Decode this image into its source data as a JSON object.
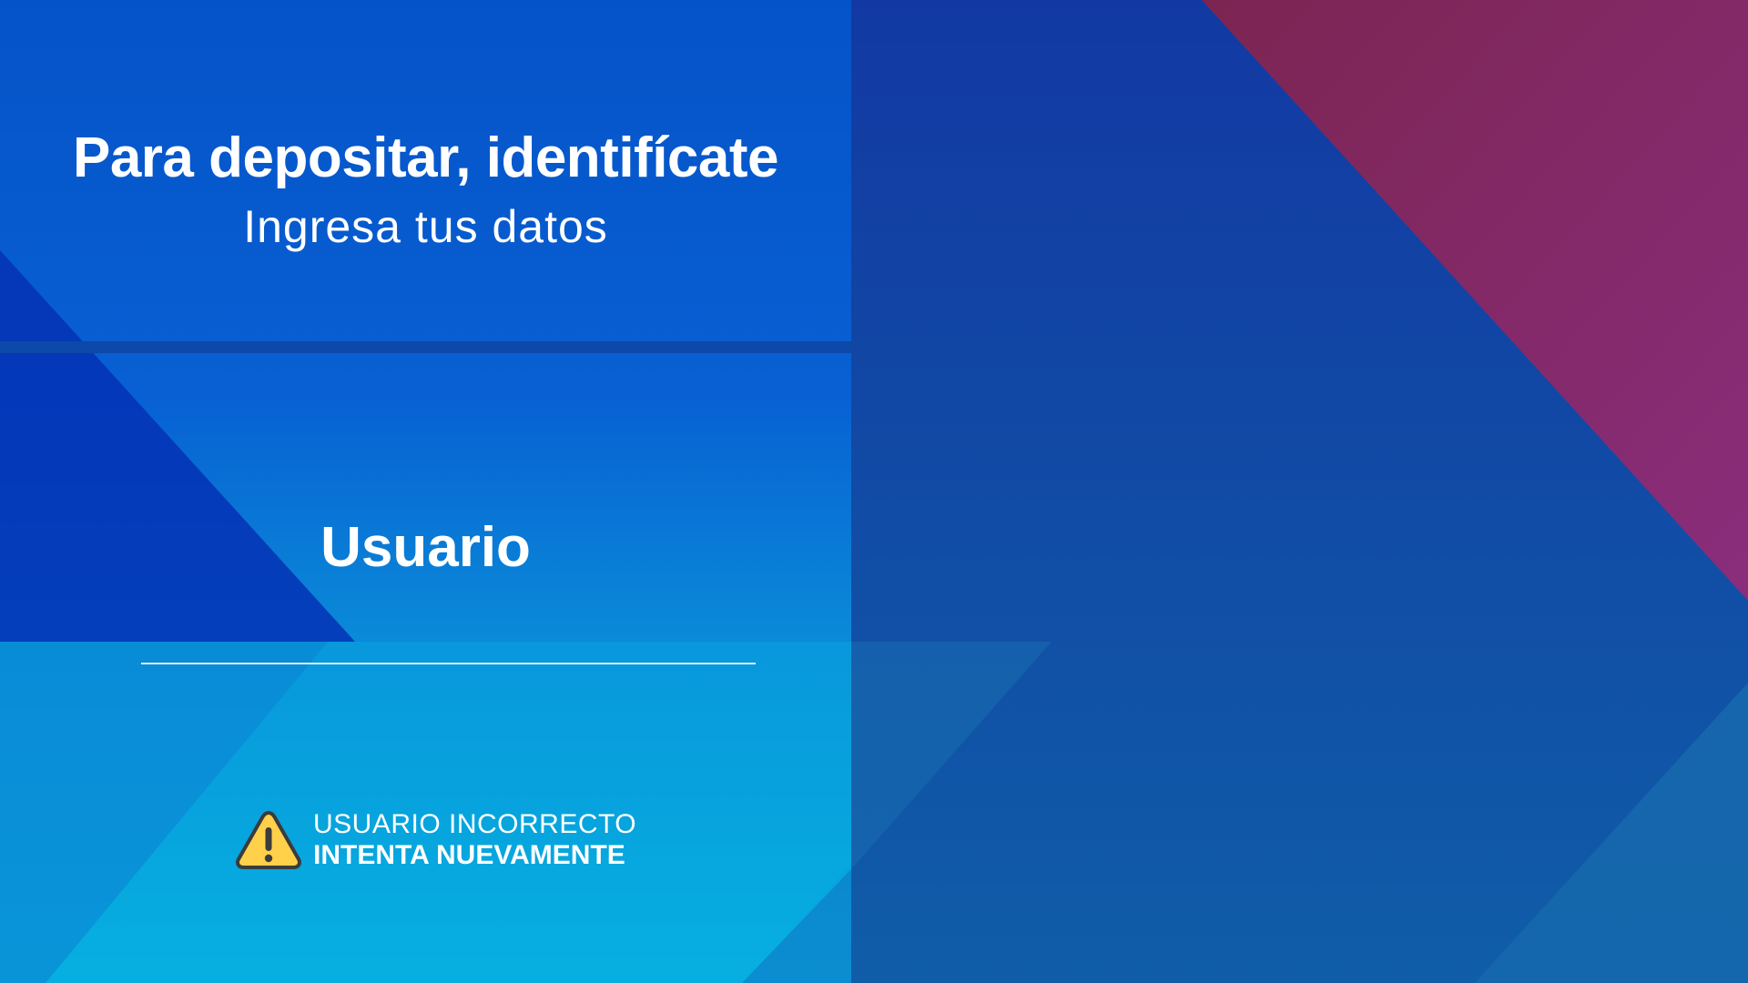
{
  "login": {
    "heading": "Para depositar, identifícate",
    "subheading": "Ingresa tus datos",
    "field_label": "Usuario",
    "user_value": "",
    "error": {
      "icon": "warning-icon",
      "line1": "USUARIO INCORRECTO",
      "line2": "INTENTA NUEVAMENTE"
    }
  },
  "colors": {
    "left_panel_top": "#0553c8",
    "left_panel_bottom": "#08aee0",
    "right_panel": "#1245a5",
    "accent_magenta": "#8b2a6a",
    "divider": "#0d49a8",
    "warning_yellow": "#ffd04a",
    "text": "#ffffff"
  }
}
